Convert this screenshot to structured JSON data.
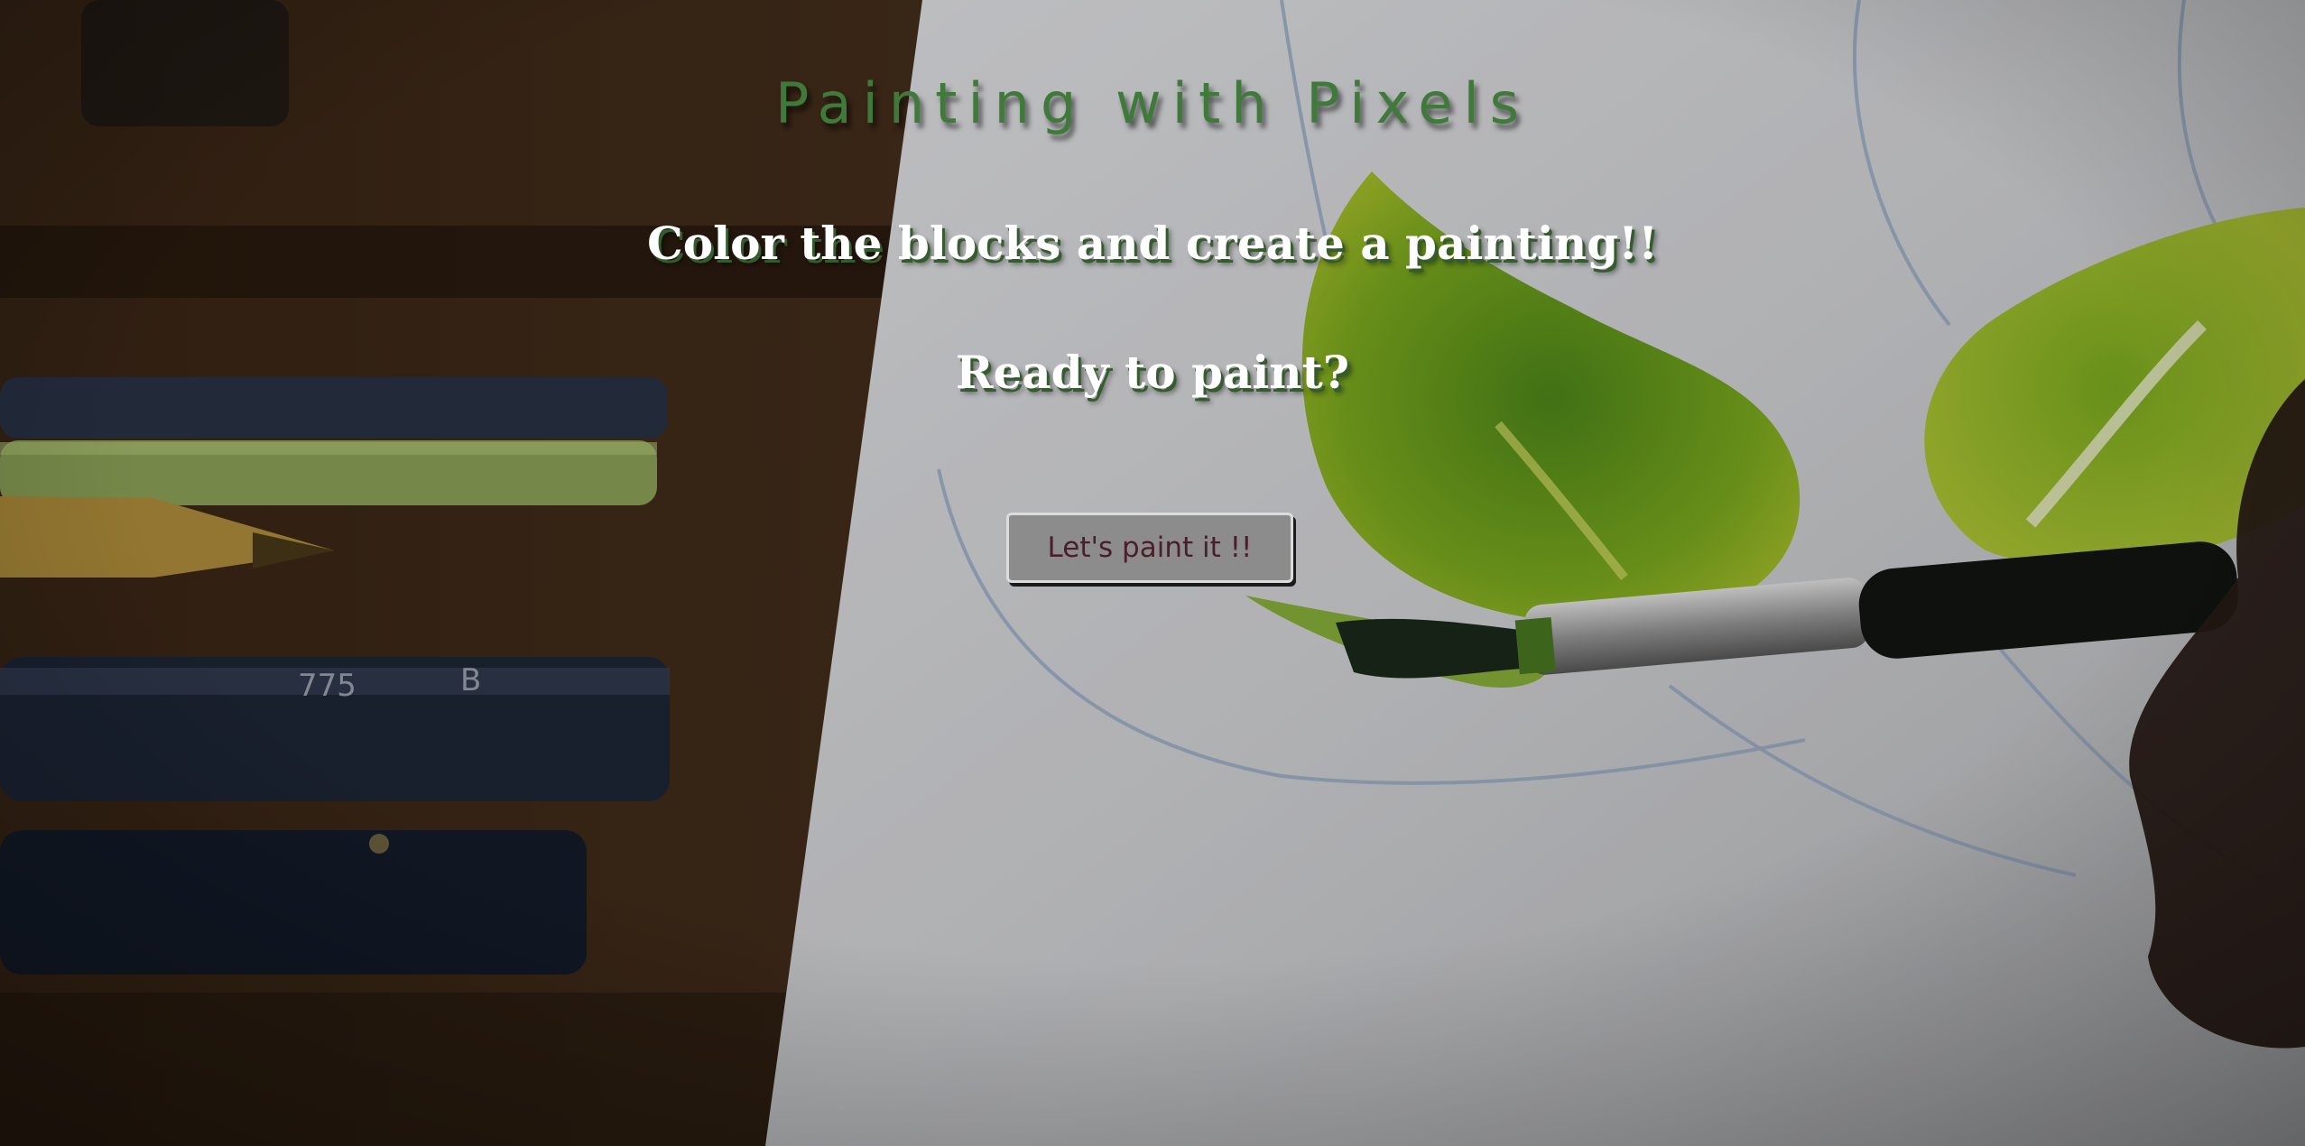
{
  "page": {
    "title": "Painting with Pixels",
    "subtitle": "Color the blocks and create a painting!!",
    "prompt": "Ready to paint?",
    "start_button_label": "Let's paint it !!"
  },
  "colors": {
    "title": "#3f7a3a",
    "text": "#ffffff",
    "text_shadow": "#355c2d",
    "button_bg": "#8c8c8c",
    "button_text": "#4a1f2c",
    "button_border": "#dcdcdc"
  }
}
